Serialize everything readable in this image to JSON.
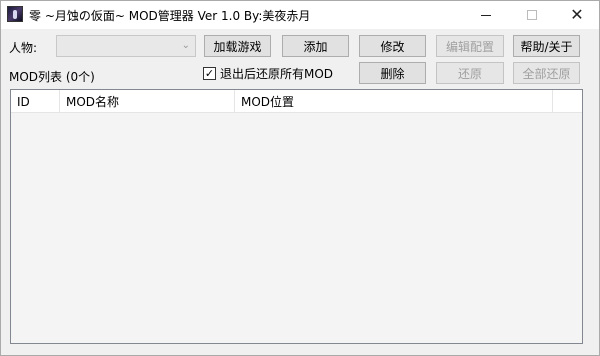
{
  "window": {
    "title": "零 ~月蚀の仮面~ MOD管理器 Ver 1.0  By:美夜赤月",
    "icon": "app-icon"
  },
  "form": {
    "character_label": "人物:",
    "character_value": "",
    "mod_list_label": "MOD列表 (0个)",
    "restore_on_exit_label": "退出后还原所有MOD",
    "restore_on_exit_checked": true
  },
  "buttons": {
    "load_game": "加载游戏",
    "add": "添加",
    "modify": "修改",
    "edit_config": "编辑配置",
    "help_about": "帮助/关于",
    "delete": "删除",
    "restore": "还原",
    "restore_all": "全部还原"
  },
  "table": {
    "columns": [
      "ID",
      "MOD名称",
      "MOD位置",
      ""
    ],
    "rows": []
  }
}
